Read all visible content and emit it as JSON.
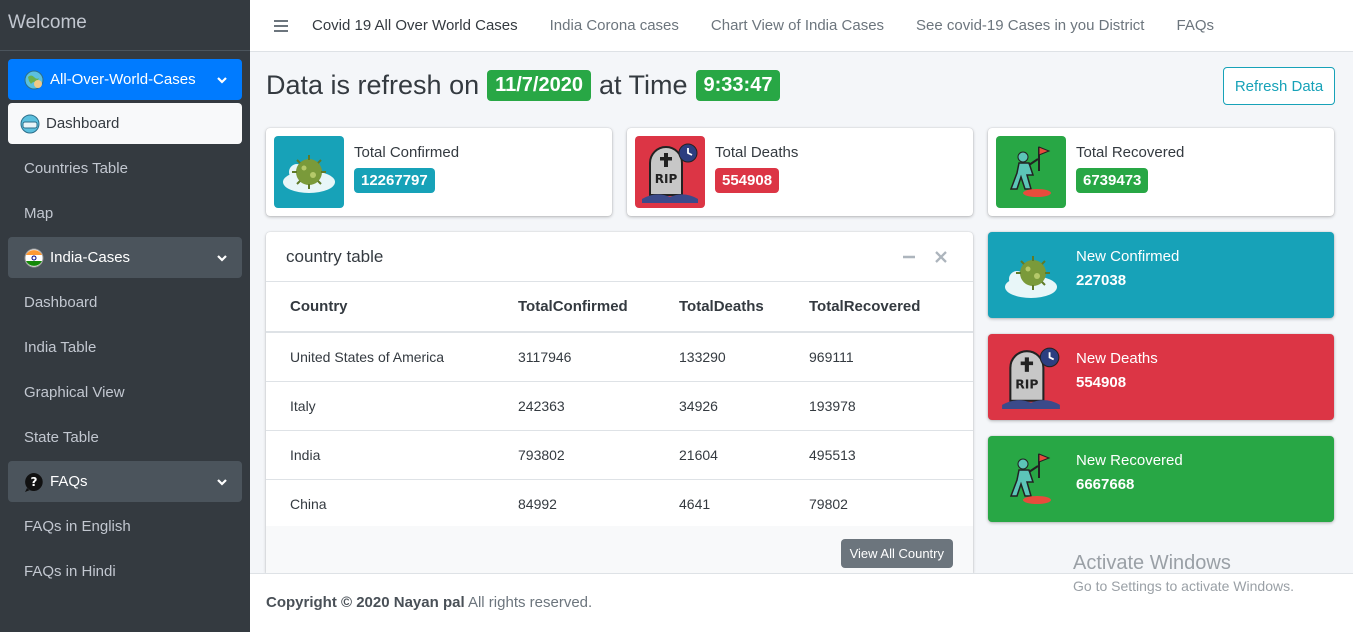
{
  "sidebar": {
    "brand": "Welcome",
    "items": [
      {
        "label": "All-Over-World-Cases",
        "type": "parent",
        "icon": "globe-icon"
      },
      {
        "label": "Dashboard",
        "type": "active",
        "icon": "globe-mask-icon"
      },
      {
        "label": "Countries Table",
        "type": "sub"
      },
      {
        "label": "Map",
        "type": "sub"
      },
      {
        "label": "India-Cases",
        "type": "parent",
        "icon": "india-flag-icon"
      },
      {
        "label": "Dashboard",
        "type": "sub"
      },
      {
        "label": "India Table",
        "type": "sub"
      },
      {
        "label": "Graphical View",
        "type": "sub"
      },
      {
        "label": "State Table",
        "type": "sub"
      },
      {
        "label": "FAQs",
        "type": "parent",
        "icon": "question-bubble-icon"
      },
      {
        "label": "FAQs in English",
        "type": "sub"
      },
      {
        "label": "FAQs in Hindi",
        "type": "sub"
      }
    ]
  },
  "topnav": {
    "links": [
      "Covid 19 All Over World Cases",
      "India Corona cases",
      "Chart View of India Cases",
      "See covid-19 Cases in you District",
      "FAQs"
    ]
  },
  "heading": {
    "prefix": "Data is refresh on",
    "date": "11/7/2020",
    "middle": "at Time",
    "time": "9:33:47"
  },
  "refresh_button": "Refresh Data",
  "info_boxes": [
    {
      "label": "Total Confirmed",
      "value": "12267797",
      "color": "#17a2b8",
      "icon": "virus-icon"
    },
    {
      "label": "Total Deaths",
      "value": "554908",
      "color": "#dc3545",
      "icon": "rip-tombstone-icon"
    },
    {
      "label": "Total Recovered",
      "value": "6739473",
      "color": "#28a745",
      "icon": "climber-flag-icon"
    }
  ],
  "country_table": {
    "title": "country table",
    "columns": [
      "Country",
      "TotalConfirmed",
      "TotalDeaths",
      "TotalRecovered"
    ],
    "rows": [
      [
        "United States of America",
        "3117946",
        "133290",
        "969111"
      ],
      [
        "Italy",
        "242363",
        "34926",
        "193978"
      ],
      [
        "India",
        "793802",
        "21604",
        "495513"
      ],
      [
        "China",
        "84992",
        "4641",
        "79802"
      ]
    ],
    "view_all_button": "View All Country"
  },
  "small_boxes": [
    {
      "label": "New Confirmed",
      "value": "227038",
      "color": "#17a2b8",
      "icon": "virus-icon"
    },
    {
      "label": "New Deaths",
      "value": "554908",
      "color": "#dc3545",
      "icon": "rip-tombstone-icon"
    },
    {
      "label": "New Recovered",
      "value": "6667668",
      "color": "#28a745",
      "icon": "climber-flag-icon"
    }
  ],
  "footer": {
    "bold": "Copyright © 2020 Nayan pal",
    "rest": " All rights reserved."
  },
  "watermark": {
    "line1": "Activate Windows",
    "line2": "Go to Settings to activate Windows."
  }
}
